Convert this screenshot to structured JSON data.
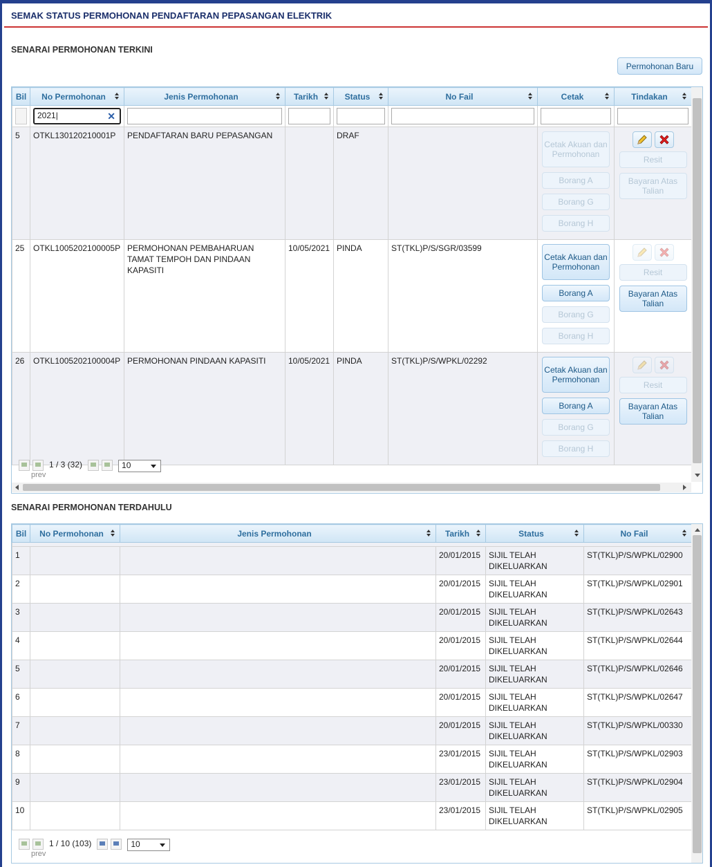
{
  "page_title": "SEMAK STATUS PERMOHONAN PENDAFTARAN PEPASANGAN ELEKTRIK",
  "current": {
    "section_title": "SENARAI PERMOHONAN TERKINI",
    "new_button": "Permohonan Baru",
    "columns": [
      "Bil",
      "No Permohonan",
      "Jenis Permohonan",
      "Tarikh",
      "Status",
      "No Fail",
      "Cetak",
      "Tindakan"
    ],
    "filter_value": "2021",
    "rows": [
      {
        "bil": "5",
        "no": "OTKL130120210001P",
        "jenis": "PENDAFTARAN BARU PEPASANGAN",
        "tarikh": "",
        "status": "DRAF",
        "fail": ""
      },
      {
        "bil": "25",
        "no": "OTKL1005202100005P",
        "jenis": "PERMOHONAN PEMBAHARUAN TAMAT TEMPOH DAN PINDAAN KAPASITI",
        "tarikh": "10/05/2021",
        "status": "PINDA",
        "fail": "ST(TKL)P/S/SGR/03599"
      },
      {
        "bil": "26",
        "no": "OTKL1005202100004P",
        "jenis": "PERMOHONAN PINDAAN KAPASITI",
        "tarikh": "10/05/2021",
        "status": "PINDA",
        "fail": "ST(TKL)P/S/WPKL/02292"
      }
    ],
    "cetak_buttons": {
      "akuan": "Cetak Akuan dan Permohonan",
      "borang_a": "Borang A",
      "borang_g": "Borang G",
      "borang_h": "Borang H"
    },
    "tindakan_buttons": {
      "resit": "Resit",
      "bayaran": "Bayaran Atas Talian"
    },
    "pager": {
      "info": "1 / 3 (32)",
      "prev": "prev",
      "page_size": "10"
    }
  },
  "past": {
    "section_title": "SENARAI PERMOHONAN TERDAHULU",
    "columns": [
      "Bil",
      "No Permohonan",
      "Jenis Permohonan",
      "Tarikh",
      "Status",
      "No Fail"
    ],
    "rows": [
      {
        "bil": "1",
        "no": "",
        "jenis": "",
        "tarikh": "20/01/2015",
        "status": "SIJIL TELAH DIKELUARKAN",
        "fail": "ST(TKL)P/S/WPKL/02900"
      },
      {
        "bil": "2",
        "no": "",
        "jenis": "",
        "tarikh": "20/01/2015",
        "status": "SIJIL TELAH DIKELUARKAN",
        "fail": "ST(TKL)P/S/WPKL/02901"
      },
      {
        "bil": "3",
        "no": "",
        "jenis": "",
        "tarikh": "20/01/2015",
        "status": "SIJIL TELAH DIKELUARKAN",
        "fail": "ST(TKL)P/S/WPKL/02643"
      },
      {
        "bil": "4",
        "no": "",
        "jenis": "",
        "tarikh": "20/01/2015",
        "status": "SIJIL TELAH DIKELUARKAN",
        "fail": "ST(TKL)P/S/WPKL/02644"
      },
      {
        "bil": "5",
        "no": "",
        "jenis": "",
        "tarikh": "20/01/2015",
        "status": "SIJIL TELAH DIKELUARKAN",
        "fail": "ST(TKL)P/S/WPKL/02646"
      },
      {
        "bil": "6",
        "no": "",
        "jenis": "",
        "tarikh": "20/01/2015",
        "status": "SIJIL TELAH DIKELUARKAN",
        "fail": "ST(TKL)P/S/WPKL/02647"
      },
      {
        "bil": "7",
        "no": "",
        "jenis": "",
        "tarikh": "20/01/2015",
        "status": "SIJIL TELAH DIKELUARKAN",
        "fail": "ST(TKL)P/S/WPKL/00330"
      },
      {
        "bil": "8",
        "no": "",
        "jenis": "",
        "tarikh": "23/01/2015",
        "status": "SIJIL TELAH DIKELUARKAN",
        "fail": "ST(TKL)P/S/WPKL/02903"
      },
      {
        "bil": "9",
        "no": "",
        "jenis": "",
        "tarikh": "23/01/2015",
        "status": "SIJIL TELAH DIKELUARKAN",
        "fail": "ST(TKL)P/S/WPKL/02904"
      },
      {
        "bil": "10",
        "no": "",
        "jenis": "",
        "tarikh": "23/01/2015",
        "status": "SIJIL TELAH DIKELUARKAN",
        "fail": "ST(TKL)P/S/WPKL/02905"
      }
    ],
    "pager": {
      "info": "1 / 10 (103)",
      "prev": "prev",
      "page_size": "10"
    }
  },
  "icons": {
    "edit": "pencil-icon",
    "delete": "delete-x-icon",
    "clear": "clear-x-icon",
    "sort": "sort-icon"
  }
}
